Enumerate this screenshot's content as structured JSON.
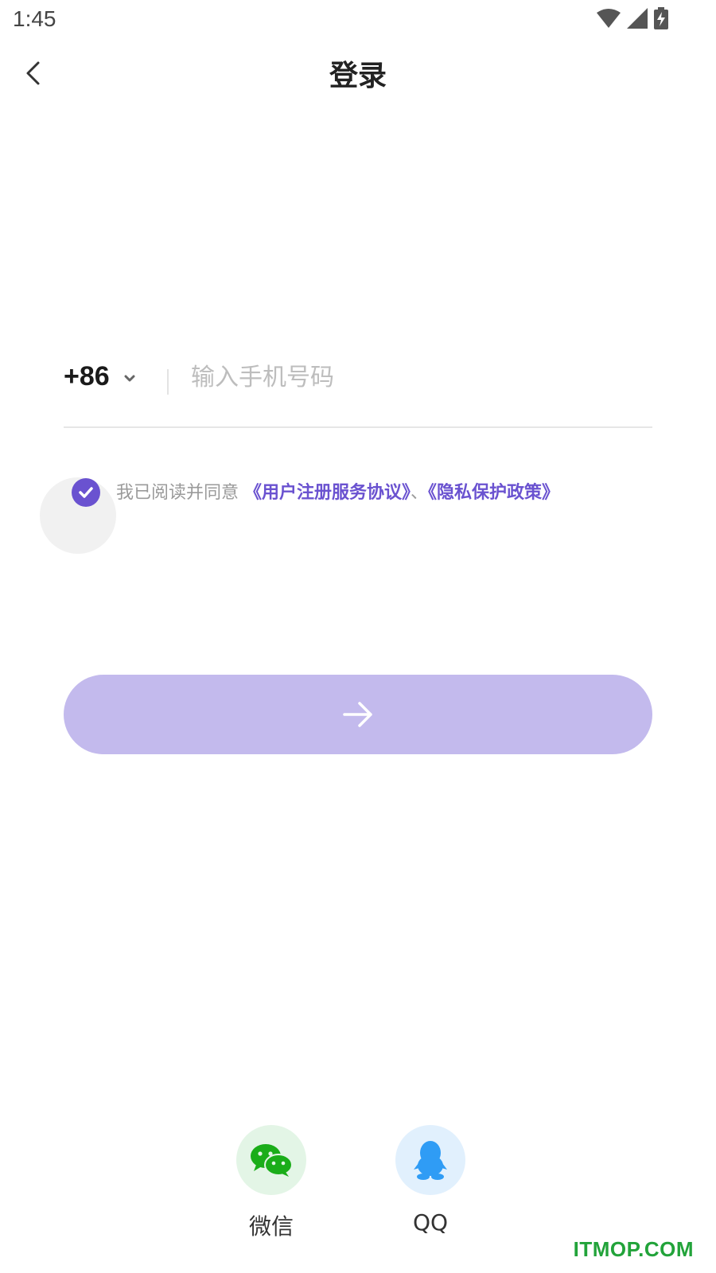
{
  "status_bar": {
    "time": "1:45",
    "icons": [
      "wifi-icon",
      "signal-icon",
      "battery-charging-icon"
    ]
  },
  "header": {
    "title": "登录",
    "back_icon": "chevron-left-icon"
  },
  "phone_form": {
    "country_code": "+86",
    "country_code_icon": "chevron-down-icon",
    "phone_value": "",
    "phone_placeholder": "输入手机号码"
  },
  "agreement": {
    "checked": true,
    "prefix": "我已阅读并同意",
    "terms_link": "《用户注册服务协议》",
    "separator": "、",
    "privacy_link": "《隐私保护政策》"
  },
  "submit": {
    "icon": "arrow-right-icon"
  },
  "social_login": [
    {
      "label": "微信",
      "icon": "wechat-icon",
      "color": "#1aad19"
    },
    {
      "label": "QQ",
      "icon": "qq-penguin-icon",
      "color": "#2f9cf5"
    }
  ],
  "watermark": "ITMOP.COM",
  "colors": {
    "accent": "#6a52d0",
    "button_disabled": "#c3baed",
    "placeholder": "#bdbdbd",
    "link": "#6a52d0"
  }
}
